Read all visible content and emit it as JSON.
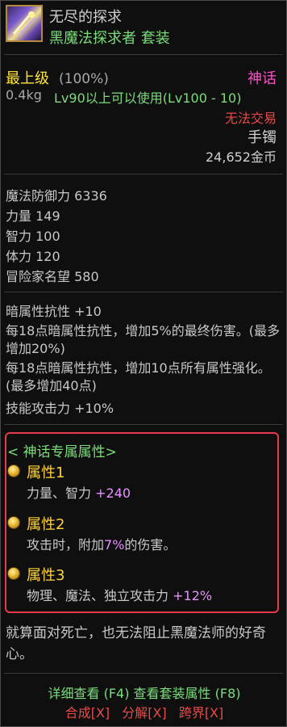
{
  "item": {
    "name": "无尽的探求",
    "set_name": "黑魔法探求者  套装",
    "grade": "最上级",
    "grade_pct": "(100%)",
    "rarity": "神话",
    "weight": "0.4kg",
    "requirement": "Lv90以上可以使用(Lv100 - 10)",
    "trade": "无法交易",
    "slot": "手镯",
    "price": "24,652金币"
  },
  "stats": [
    {
      "label": "魔法防御力",
      "value": "6336"
    },
    {
      "label": "力量",
      "value": "149"
    },
    {
      "label": "智力",
      "value": "100"
    },
    {
      "label": "体力",
      "value": "120"
    },
    {
      "label": "冒险家名望",
      "value": "580"
    }
  ],
  "effects": [
    "暗属性抗性 +10",
    "每18点暗属性抗性，增加5%的最终伤害。(最多增加20%)",
    "每18点暗属性抗性，增加10点所有属性强化。(最多增加40点)",
    "技能攻击力 +10%"
  ],
  "mythic": {
    "header": "< 神话专属属性>",
    "attributes": [
      {
        "name": "属性1",
        "desc": "力量、智力",
        "value": "+240",
        "suffix": ""
      },
      {
        "name": "属性2",
        "desc": "攻击时，附加",
        "value": "7%",
        "suffix": "的伤害。"
      },
      {
        "name": "属性3",
        "desc": "物理、魔法、独立攻击力",
        "value": "+12%",
        "suffix": ""
      }
    ]
  },
  "lore": "就算面对死亡，也无法阻止黑魔法师的好奇心。",
  "footer": {
    "detail_hint": "详细查看 (F4) 查看套装属性 (F8)",
    "actions": [
      "合成[X]",
      "分解[X]",
      "跨界[X]"
    ]
  },
  "colors": {
    "set_green": "#7cdc7c",
    "grade_yellow": "#ffe23a",
    "mythic_pink": "#ff4fc8",
    "untradeable_red": "#e84a4a",
    "highlight_box": "#e83a4a",
    "attr_value": "#e890ff"
  }
}
